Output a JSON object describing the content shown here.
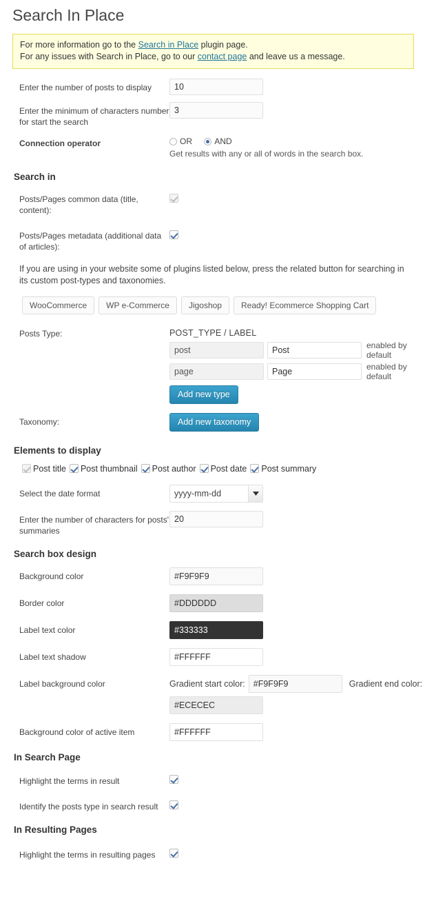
{
  "page": {
    "title": "Search In Place"
  },
  "notice": {
    "line1_pre": "For more information go to the ",
    "line1_link": "Search in Place",
    "line1_post": " plugin page.",
    "line2_pre": "For any issues with Search in Place, go to our ",
    "line2_link": "contact page",
    "line2_post": " and leave us a message."
  },
  "general": {
    "posts_to_display_label": "Enter the number of posts to display",
    "posts_to_display_value": "10",
    "min_chars_label": "Enter the minimum of characters number for start the search",
    "min_chars_value": "3",
    "connection_operator_label": "Connection operator",
    "operator_or": "OR",
    "operator_and": "AND",
    "operator_selected": "AND",
    "operator_hint": "Get results with any or all of words in the search box."
  },
  "search_in": {
    "heading": "Search in",
    "common_data_label": "Posts/Pages common data (title, content):",
    "common_data_checked": true,
    "common_data_disabled": true,
    "metadata_label": "Posts/Pages metadata (additional data of articles):",
    "metadata_checked": true,
    "metadata_disabled": false,
    "plugins_note": "If you are using in your website some of plugins listed below, press the related button for searching in its custom post-types and taxonomies.",
    "plugin_buttons": [
      "WooCommerce",
      "WP e-Commerce",
      "Jigoshop",
      "Ready! Ecommerce Shopping Cart"
    ]
  },
  "posts_type": {
    "label": "Posts Type:",
    "column_header": "POST_TYPE / LABEL",
    "rows": [
      {
        "slug": "post",
        "label": "Post",
        "note": "enabled by default"
      },
      {
        "slug": "page",
        "label": "Page",
        "note": "enabled by default"
      }
    ],
    "add_button": "Add new type"
  },
  "taxonomy": {
    "label": "Taxonomy:",
    "add_button": "Add new taxonomy"
  },
  "elements_to_display": {
    "heading": "Elements to display",
    "items": [
      {
        "label": "Post title",
        "checked": true,
        "disabled": true
      },
      {
        "label": "Post thumbnail",
        "checked": true,
        "disabled": false
      },
      {
        "label": "Post author",
        "checked": true,
        "disabled": false
      },
      {
        "label": "Post date",
        "checked": true,
        "disabled": false
      },
      {
        "label": "Post summary",
        "checked": true,
        "disabled": false
      }
    ],
    "date_format_label": "Select the date format",
    "date_format_value": "yyyy-mm-dd",
    "summary_chars_label": "Enter the number of characters for posts' summaries",
    "summary_chars_value": "20"
  },
  "search_box_design": {
    "heading": "Search box design",
    "background_color_label": "Background color",
    "background_color_value": "#F9F9F9",
    "border_color_label": "Border color",
    "border_color_value": "#DDDDDD",
    "label_text_color_label": "Label text color",
    "label_text_color_value": "#333333",
    "label_text_shadow_label": "Label text shadow",
    "label_text_shadow_value": "#FFFFFF",
    "label_bg_label": "Label background color",
    "gradient_start_label": "Gradient start color:",
    "gradient_start_value": "#F9F9F9",
    "gradient_end_label": "Gradient end color:",
    "gradient_end_value": "#ECECEC",
    "active_item_label": "Background color of active item",
    "active_item_value": "#FFFFFF"
  },
  "in_search_page": {
    "heading": "In Search Page",
    "highlight_label": "Highlight the terms in result",
    "highlight_checked": true,
    "identify_label": "Identify the posts type in search result",
    "identify_checked": true
  },
  "in_resulting_pages": {
    "heading": "In Resulting Pages",
    "highlight_label": "Highlight the terms in resulting pages",
    "highlight_checked": true
  },
  "colors": {
    "accent_blue": "#2585ae",
    "link_blue": "#21759b",
    "notice_bg": "#FFFFE0",
    "notice_border": "#E6DB55"
  }
}
